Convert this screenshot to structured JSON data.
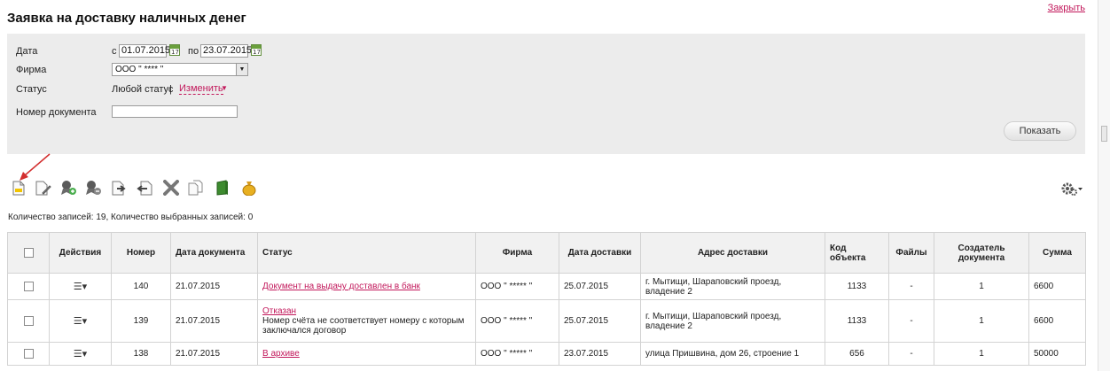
{
  "page": {
    "title": "Заявка на доставку наличных денег",
    "close_label": "Закрыть"
  },
  "filters": {
    "date_label": "Дата",
    "date_from_prefix": "с",
    "date_from": "01.07.2015",
    "date_to_prefix": "по",
    "date_to": "23.07.2015",
    "calendar_icon_text": "17",
    "firm_label": "Фирма",
    "firm_value": "ООО \" **** \"",
    "status_label": "Статус",
    "status_value": "Любой статус",
    "status_separator": "|",
    "status_change_label": "Изменить",
    "doc_number_label": "Номер документа",
    "doc_number_value": "",
    "show_button_label": "Показать"
  },
  "toolbar": {
    "icons": [
      "new-document-icon",
      "edit-document-icon",
      "user-add-icon",
      "user-remove-icon",
      "send-document-icon",
      "return-document-icon",
      "delete-icon",
      "copy-icon",
      "archive-book-icon",
      "money-bag-icon"
    ],
    "settings_icon": "gear-icon"
  },
  "records_info": "Количество записей: 19, Количество выбранных записей: 0",
  "table": {
    "headers": {
      "actions": "Действия",
      "number": "Номер",
      "doc_date": "Дата документа",
      "status": "Статус",
      "firm": "Фирма",
      "delivery_date": "Дата доставки",
      "address": "Адрес доставки",
      "object_code": "Код объекта",
      "files": "Файлы",
      "creator": "Создатель документа",
      "sum": "Сумма"
    },
    "rows": [
      {
        "number": "140",
        "doc_date": "21.07.2015",
        "status_link": "Документ на выдачу доставлен в банк",
        "status_note": "",
        "firm": "ООО \" ***** \"",
        "delivery_date": "25.07.2015",
        "address": "г. Мытищи, Шараповский проезд, владение 2",
        "object_code": "1133",
        "files": "-",
        "creator": "1",
        "sum": "6600"
      },
      {
        "number": "139",
        "doc_date": "21.07.2015",
        "status_link": "Отказан",
        "status_note": "Номер счёта не соответствует номеру с которым заключался договор",
        "firm": "ООО \" ***** \"",
        "delivery_date": "25.07.2015",
        "address": "г. Мытищи, Шараповский проезд, владение 2",
        "object_code": "1133",
        "files": "-",
        "creator": "1",
        "sum": "6600"
      },
      {
        "number": "138",
        "doc_date": "21.07.2015",
        "status_link": "В архиве",
        "status_note": "",
        "firm": "ООО \" ***** \"",
        "delivery_date": "23.07.2015",
        "address": "улица Пришвина, дом 26, строение 1",
        "object_code": "656",
        "files": "-",
        "creator": "1",
        "sum": "50000"
      }
    ]
  },
  "colors": {
    "accent": "#c2185b",
    "panel_bg": "#ececec",
    "header_bg": "#f1f1f1"
  }
}
